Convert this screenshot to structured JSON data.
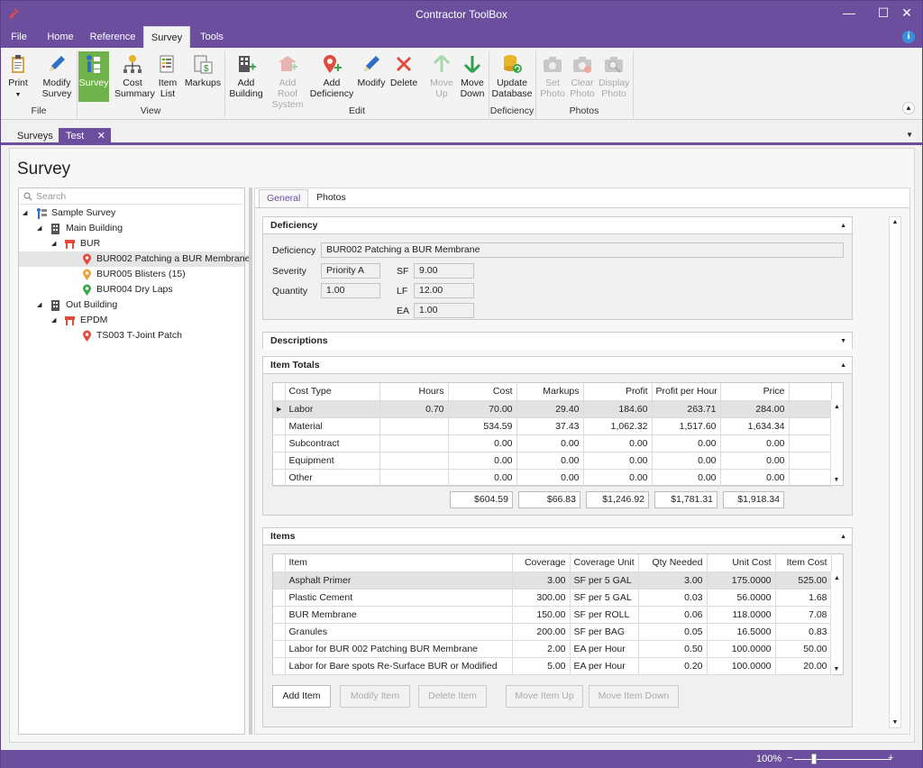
{
  "app": {
    "title": "Contractor ToolBox"
  },
  "colors": {
    "accent": "#6b4f9e",
    "selected_button": "#6fb24b"
  },
  "menu": [
    {
      "label": "File"
    },
    {
      "label": "Home"
    },
    {
      "label": "Reference"
    },
    {
      "label": "Survey"
    },
    {
      "label": "Tools"
    }
  ],
  "ribbon": {
    "print": {
      "label": "Print",
      "icon": "clipboard-icon"
    },
    "modify_survey": {
      "label": "Modify Survey"
    },
    "survey": {
      "label": "Survey"
    },
    "cost_summary": {
      "label": "Cost Summary"
    },
    "item_list": {
      "label": "Item List"
    },
    "markups": {
      "label": "Markups"
    },
    "add_building": {
      "label": "Add Building"
    },
    "add_roof_system": {
      "label": "Add Roof System"
    },
    "add_deficiency": {
      "label": "Add Deficiency"
    },
    "modify": {
      "label": "Modify"
    },
    "delete": {
      "label": "Delete"
    },
    "move_up": {
      "label": "Move Up"
    },
    "move_down": {
      "label": "Move Down"
    },
    "update_database": {
      "label": "Update Database"
    },
    "set_photo": {
      "label": "Set Photo"
    },
    "clear_photo": {
      "label": "Clear Photo"
    },
    "display_photo": {
      "label": "Display Photo"
    },
    "groups": {
      "file": "File",
      "view": "View",
      "edit": "Edit",
      "deficiency": "Deficiency",
      "photos": "Photos"
    }
  },
  "doc_tabs": [
    {
      "label": "Surveys"
    },
    {
      "label": "Test"
    }
  ],
  "page_title": "Survey",
  "tree": {
    "search_placeholder": "Search",
    "nodes": [
      {
        "label": "Sample Survey",
        "icon": "survey-icon"
      },
      {
        "label": "Main Building",
        "icon": "building-icon"
      },
      {
        "label": "BUR",
        "icon": "roof-icon"
      },
      {
        "label": "BUR002 Patching a BUR Membrane",
        "icon": "pin-red-icon"
      },
      {
        "label": "BUR005 Blisters (15)",
        "icon": "pin-orange-icon"
      },
      {
        "label": "BUR004 Dry Laps",
        "icon": "pin-green-icon"
      },
      {
        "label": "Out Building",
        "icon": "building-icon"
      },
      {
        "label": "EPDM",
        "icon": "roof-icon"
      },
      {
        "label": "TS003 T-Joint Patch",
        "icon": "pin-red-icon"
      }
    ]
  },
  "detail_tabs": [
    {
      "label": "General"
    },
    {
      "label": "Photos"
    }
  ],
  "deficiency": {
    "header": "Deficiency",
    "deficiency_label": "Deficiency",
    "deficiency_value": "BUR002 Patching a BUR Membrane",
    "severity_label": "Severity",
    "severity_value": "Priority A",
    "quantity_label": "Quantity",
    "quantity_value": "1.00",
    "sf_label": "SF",
    "sf_value": "9.00",
    "lf_label": "LF",
    "lf_value": "12.00",
    "ea_label": "EA",
    "ea_value": "1.00"
  },
  "descriptions": {
    "header": "Descriptions"
  },
  "item_totals": {
    "header": "Item Totals",
    "columns": [
      "Cost Type",
      "Hours",
      "Cost",
      "Markups",
      "Profit",
      "Profit per Hour",
      "Price"
    ],
    "rows": [
      [
        "Labor",
        "0.70",
        "70.00",
        "29.40",
        "184.60",
        "263.71",
        "284.00"
      ],
      [
        "Material",
        "",
        "534.59",
        "37.43",
        "1,062.32",
        "1,517.60",
        "1,634.34"
      ],
      [
        "Subcontract",
        "",
        "0.00",
        "0.00",
        "0.00",
        "0.00",
        "0.00"
      ],
      [
        "Equipment",
        "",
        "0.00",
        "0.00",
        "0.00",
        "0.00",
        "0.00"
      ],
      [
        "Other",
        "",
        "0.00",
        "0.00",
        "0.00",
        "0.00",
        "0.00"
      ]
    ],
    "totals": [
      "$604.59",
      "$66.83",
      "$1,246.92",
      "$1,781.31",
      "$1,918.34"
    ]
  },
  "items": {
    "header": "Items",
    "columns": [
      "Item",
      "Coverage",
      "Coverage Unit",
      "Qty Needed",
      "Unit Cost",
      "Item Cost"
    ],
    "rows": [
      [
        "Asphalt Primer",
        "3.00",
        "SF per 5 GAL",
        "3.00",
        "175.0000",
        "525.00"
      ],
      [
        "Plastic Cement",
        "300.00",
        "SF per 5 GAL",
        "0.03",
        "56.0000",
        "1.68"
      ],
      [
        "BUR Membrane",
        "150.00",
        "SF per ROLL",
        "0.06",
        "118.0000",
        "7.08"
      ],
      [
        "Granules",
        "200.00",
        "SF per BAG",
        "0.05",
        "16.5000",
        "0.83"
      ],
      [
        "Labor for BUR 002 Patching BUR Membrane",
        "2.00",
        "EA per Hour",
        "0.50",
        "100.0000",
        "50.00"
      ],
      [
        "Labor for Bare spots Re-Surface BUR or Modified",
        "5.00",
        "EA per Hour",
        "0.20",
        "100.0000",
        "20.00"
      ]
    ],
    "buttons": {
      "add": "Add Item",
      "modify": "Modify Item",
      "delete": "Delete Item",
      "move_up": "Move Item Up",
      "move_down": "Move Item Down"
    }
  },
  "status": {
    "zoom": "100%"
  }
}
